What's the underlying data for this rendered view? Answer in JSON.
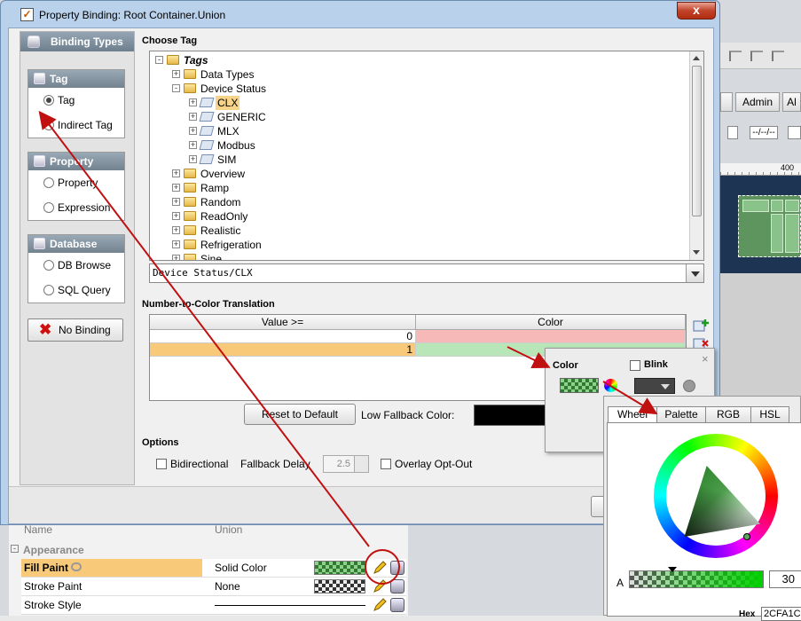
{
  "window": {
    "title": "Property Binding: Root Container.Union",
    "close_label": "x"
  },
  "binding_types": {
    "header": "Binding Types",
    "groups": [
      {
        "title": "Tag",
        "options": [
          {
            "label": "Tag",
            "selected": true
          },
          {
            "label": "Indirect Tag",
            "selected": false
          }
        ]
      },
      {
        "title": "Property",
        "options": [
          {
            "label": "Property",
            "selected": false
          },
          {
            "label": "Expression",
            "selected": false
          }
        ]
      },
      {
        "title": "Database",
        "options": [
          {
            "label": "DB Browse",
            "selected": false
          },
          {
            "label": "SQL Query",
            "selected": false
          }
        ]
      }
    ],
    "no_binding_label": "No Binding"
  },
  "choose_tag": {
    "title": "Choose Tag",
    "tree": [
      {
        "label": "Tags",
        "depth": 0,
        "icon": "folder-open-icon",
        "toggle": "-",
        "italic": true
      },
      {
        "label": "Data Types",
        "depth": 1,
        "icon": "folder-icon",
        "toggle": "+"
      },
      {
        "label": "Device Status",
        "depth": 1,
        "icon": "folder-open-icon",
        "toggle": "-"
      },
      {
        "label": "CLX",
        "depth": 2,
        "icon": "tag-icon",
        "toggle": "+",
        "selected": true
      },
      {
        "label": "GENERIC",
        "depth": 2,
        "icon": "tag-icon",
        "toggle": "+"
      },
      {
        "label": "MLX",
        "depth": 2,
        "icon": "tag-icon",
        "toggle": "+"
      },
      {
        "label": "Modbus",
        "depth": 2,
        "icon": "tag-icon",
        "toggle": "+"
      },
      {
        "label": "SIM",
        "depth": 2,
        "icon": "tag-icon",
        "toggle": "+"
      },
      {
        "label": "Overview",
        "depth": 1,
        "icon": "folder-icon",
        "toggle": "+"
      },
      {
        "label": "Ramp",
        "depth": 1,
        "icon": "folder-icon",
        "toggle": "+"
      },
      {
        "label": "Random",
        "depth": 1,
        "icon": "folder-icon",
        "toggle": "+"
      },
      {
        "label": "ReadOnly",
        "depth": 1,
        "icon": "folder-icon",
        "toggle": "+"
      },
      {
        "label": "Realistic",
        "depth": 1,
        "icon": "folder-icon",
        "toggle": "+"
      },
      {
        "label": "Refrigeration",
        "depth": 1,
        "icon": "folder-icon",
        "toggle": "+"
      },
      {
        "label": "Sine",
        "depth": 1,
        "icon": "folder-icon",
        "toggle": "+"
      }
    ],
    "selected_path": "Device Status/CLX"
  },
  "translation": {
    "title": "Number-to-Color Translation",
    "columns": [
      "Value >=",
      "Color"
    ],
    "rows": [
      {
        "value": "0",
        "color": "#f7b8b8",
        "selected": false
      },
      {
        "value": "1",
        "color": "#b9e6b9",
        "selected": true
      }
    ],
    "reset_label": "Reset to Default",
    "fallback_label": "Low Fallback Color:",
    "fallback_color": "#000000"
  },
  "options": {
    "title": "Options",
    "bidirectional_label": "Bidirectional",
    "fallback_delay_label": "Fallback Delay",
    "fallback_delay_value": "2.5",
    "overlay_label": "Overlay Opt-Out"
  },
  "color_popup": {
    "color_label": "Color",
    "blink_label": "Blink",
    "close_label": "×"
  },
  "color_chooser": {
    "tabs": [
      "Wheel",
      "Palette",
      "RGB",
      "HSL"
    ],
    "active_tab": "Wheel",
    "alpha_label": "A",
    "alpha_value": "30",
    "hex_label": "Hex",
    "hex_value": "2CFA1C"
  },
  "background": {
    "tabs": [
      "Admin",
      "Al"
    ],
    "gadgets": [
      "--/--/--"
    ],
    "ruler_label": "400",
    "properties": {
      "truncated_row": {
        "name": "Name",
        "value": "Union"
      },
      "section": "Appearance",
      "rows": [
        {
          "name": "Fill Paint",
          "value": "Solid Color",
          "swatch": "green",
          "highlight": true
        },
        {
          "name": "Stroke Paint",
          "value": "None",
          "swatch": "checker"
        },
        {
          "name": "Stroke Style",
          "value": "",
          "swatch": "line"
        }
      ]
    }
  },
  "colors": {
    "accent_red": "#c01010",
    "selection_orange": "#f7d48a"
  }
}
